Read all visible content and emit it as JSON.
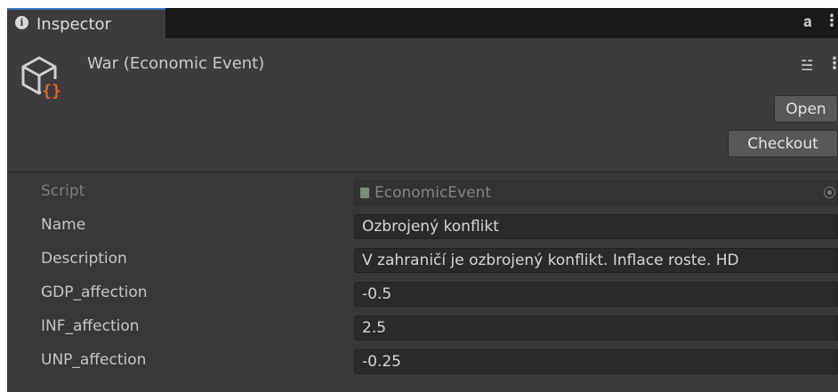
{
  "tab": {
    "label": "Inspector"
  },
  "header": {
    "title": "War (Economic Event)",
    "open_label": "Open",
    "checkout_label": "Checkout"
  },
  "properties": [
    {
      "label": "Script",
      "value": "EconomicEvent",
      "disabled": true
    },
    {
      "label": "Name",
      "value": "Ozbrojený konflikt"
    },
    {
      "label": "Description",
      "value": "V zahraničí je ozbrojený konflikt. Inflace roste. HD"
    },
    {
      "label": "GDP_affection",
      "value": "-0.5"
    },
    {
      "label": "INF_affection",
      "value": "2.5"
    },
    {
      "label": "UNP_affection",
      "value": "-0.25"
    }
  ],
  "colors": {
    "panel_bg": "#383838",
    "tab_accent": "#3a79bb",
    "field_bg": "#2a2a2a",
    "icon_accent": "#e8642e"
  },
  "icons": [
    "info-icon",
    "lock-icon",
    "menu-icon",
    "scriptable-object-icon",
    "settings-icon",
    "script-file-icon",
    "object-picker-icon"
  ]
}
